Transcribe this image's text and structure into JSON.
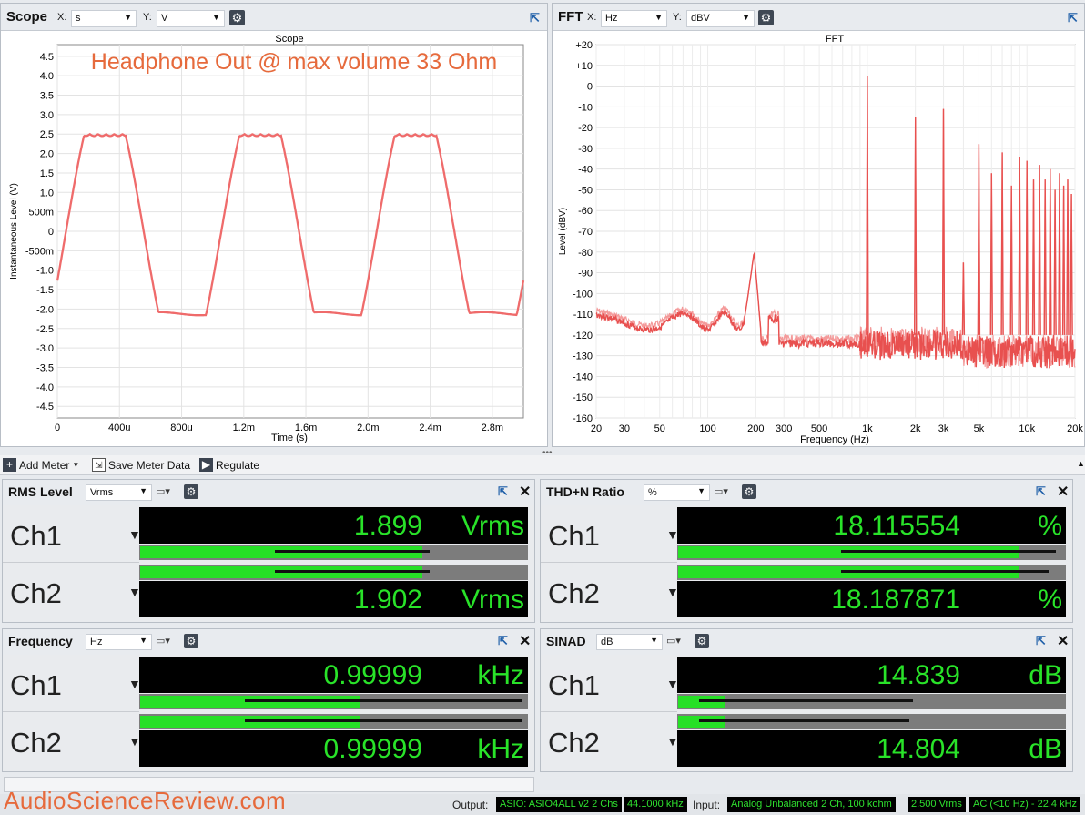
{
  "scope": {
    "title": "Scope",
    "x_label": "X:",
    "x_unit": "s",
    "y_label": "Y:",
    "y_unit": "V",
    "plot_title": "Scope",
    "annotation": "Headphone Out @ max volume 33 Ohm",
    "xlabel": "Time (s)",
    "ylabel": "Instantaneous Level (V)",
    "yticks": [
      "4.5",
      "4.0",
      "3.5",
      "3.0",
      "2.5",
      "2.0",
      "1.5",
      "1.0",
      "500m",
      "0",
      "-500m",
      "-1.0",
      "-1.5",
      "-2.0",
      "-2.5",
      "-3.0",
      "-3.5",
      "-4.0",
      "-4.5"
    ],
    "xticks": [
      "0",
      "400u",
      "800u",
      "1.2m",
      "1.6m",
      "2.0m",
      "2.4m",
      "2.8m"
    ]
  },
  "fft": {
    "title": "FFT",
    "x_label": "X:",
    "x_unit": "Hz",
    "y_label": "Y:",
    "y_unit": "dBV",
    "plot_title": "FFT",
    "xlabel": "Frequency (Hz)",
    "ylabel": "Level (dBV)",
    "yticks": [
      "+20",
      "+10",
      "0",
      "-10",
      "-20",
      "-30",
      "-40",
      "-50",
      "-60",
      "-70",
      "-80",
      "-90",
      "-100",
      "-110",
      "-120",
      "-130",
      "-140",
      "-150",
      "-160"
    ],
    "xticks": [
      "20",
      "30",
      "50",
      "100",
      "200",
      "300",
      "500",
      "1k",
      "2k",
      "3k",
      "5k",
      "10k",
      "20k"
    ]
  },
  "toolbar": {
    "add_meter": "Add Meter",
    "save_meter": "Save Meter Data",
    "regulate": "Regulate"
  },
  "meters": {
    "rms": {
      "name": "RMS Level",
      "unit_sel": "Vrms",
      "ch1": "Ch1",
      "ch2": "Ch2",
      "v1": "1.899",
      "v2": "1.902",
      "u": "Vrms",
      "fill1": 0.73,
      "peak1": 0.75,
      "fill2": 0.73,
      "peak2": 0.75
    },
    "thd": {
      "name": "THD+N Ratio",
      "unit_sel": "%",
      "ch1": "Ch1",
      "ch2": "Ch2",
      "v1": "18.115554",
      "v2": "18.187871",
      "u": "%",
      "fill1": 0.88,
      "peak1": 0.98,
      "fill2": 0.88,
      "peak2": 0.96
    },
    "freq": {
      "name": "Frequency",
      "unit_sel": "Hz",
      "ch1": "Ch1",
      "ch2": "Ch2",
      "v1": "0.99999",
      "v2": "0.99999",
      "u": "kHz",
      "fill1": 0.57,
      "peak1": 0.99,
      "fill2": 0.57,
      "peak2": 0.99
    },
    "sinad": {
      "name": "SINAD",
      "unit_sel": "dB",
      "ch1": "Ch1",
      "ch2": "Ch2",
      "v1": "14.839",
      "v2": "14.804",
      "u": "dB",
      "fill1": 0.12,
      "peak1": 0.61,
      "fill2": 0.12,
      "peak2": 0.6
    }
  },
  "status": {
    "output_label": "Output:",
    "output_dev": "ASIO: ASIO4ALL v2 2 Chs",
    "output_rate": "44.1000 kHz",
    "input_label": "Input:",
    "input_dev": "Analog Unbalanced 2 Ch, 100 kohm",
    "input_range": "2.500 Vrms",
    "input_coupling": "AC (<10 Hz) - 22.4 kHz"
  },
  "watermark": "AudioScienceReview.com",
  "colors": {
    "trace": "#ef6b6b",
    "meter_green": "#26e026",
    "annotation": "#e66a3c"
  }
}
